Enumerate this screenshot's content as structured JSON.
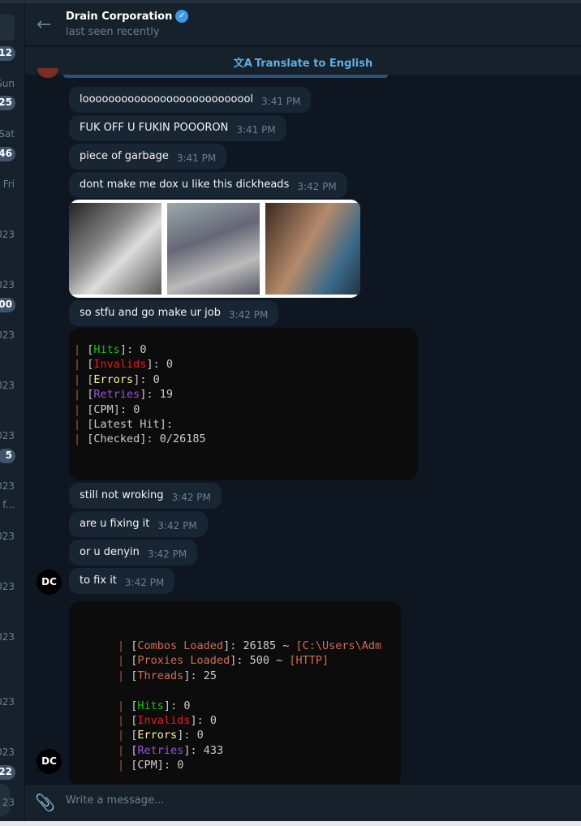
{
  "chat_list_strip": {
    "items": [
      {
        "type": "badge",
        "text": "12"
      },
      {
        "type": "date",
        "text": "Sun"
      },
      {
        "type": "badge",
        "text": "25"
      },
      {
        "type": "date",
        "text": "Sat"
      },
      {
        "type": "badge",
        "text": "46"
      },
      {
        "type": "date",
        "text": "Fri"
      },
      {
        "type": "date",
        "text": "023"
      },
      {
        "type": "date",
        "text": "023"
      },
      {
        "type": "badge",
        "text": "00"
      },
      {
        "type": "date",
        "text": "023"
      },
      {
        "type": "date",
        "text": "023"
      },
      {
        "type": "date",
        "text": "023"
      },
      {
        "type": "badge",
        "text": "5"
      },
      {
        "type": "date",
        "text": "023"
      },
      {
        "type": "date",
        "text": "y f..."
      },
      {
        "type": "date",
        "text": "023"
      },
      {
        "type": "date",
        "text": "023"
      },
      {
        "type": "date",
        "text": "023"
      },
      {
        "type": "date",
        "text": "023"
      },
      {
        "type": "date",
        "text": "023"
      },
      {
        "type": "badge",
        "text": "22"
      },
      {
        "type": "date",
        "text": "23"
      }
    ]
  },
  "header": {
    "title": "Drain Corporation",
    "verified": true,
    "status": "last seen recently",
    "back_icon": "arrow-left-icon"
  },
  "translate_bar": {
    "label": "Translate to English",
    "icon": "translate-icon"
  },
  "messages": [
    {
      "text": "looooooooooooooooooooooooool",
      "time": "3:41 PM"
    },
    {
      "text": "FUK OFF U FUKIN POOORON",
      "time": "3:41 PM"
    },
    {
      "text": "piece of garbage",
      "time": "3:41 PM"
    },
    {
      "text": "dont make me dox u like this dickheads",
      "time": "3:42 PM"
    },
    {
      "text": "so stfu and go make ur job",
      "time": "3:42 PM"
    },
    {
      "text": "still not wroking",
      "time": "3:42 PM"
    },
    {
      "text": "are u fixing it",
      "time": "3:42 PM"
    },
    {
      "text": "or u denyin",
      "time": "3:42 PM"
    },
    {
      "text": "to fix it",
      "time": "3:42 PM"
    }
  ],
  "code1": [
    {
      "label": "Hits",
      "color": "g",
      "value": ": 0"
    },
    {
      "label": "Invalids",
      "color": "r",
      "value": ": 0"
    },
    {
      "label": "Errors",
      "color": "y",
      "value": ": 0"
    },
    {
      "label": "Retries",
      "color": "p",
      "value": ": 19"
    },
    {
      "label": "CPM",
      "color": "",
      "value": ": 0"
    },
    {
      "label": "Latest Hit",
      "color": "",
      "value": ":"
    },
    {
      "label": "Checked",
      "color": "",
      "value": ": 0/26185"
    }
  ],
  "code2": [
    {
      "label": "Combos Loaded",
      "color": "o",
      "value": ": 26185 ~ ",
      "extra": "[C:\\Users\\Adm"
    },
    {
      "label": "Proxies Loaded",
      "color": "o",
      "value": ": 500 ~ ",
      "extra": "[HTTP]"
    },
    {
      "label": "Threads",
      "color": "o",
      "value": ": 25"
    },
    {
      "blank": true
    },
    {
      "label": "Hits",
      "color": "g",
      "value": ": 0"
    },
    {
      "label": "Invalids",
      "color": "r",
      "value": ": 0"
    },
    {
      "label": "Errors",
      "color": "y",
      "value": ": 0"
    },
    {
      "label": "Retries",
      "color": "p",
      "value": ": 433"
    },
    {
      "label": "CPM",
      "color": "",
      "value": ": 0"
    }
  ],
  "avatar_text": "DC",
  "composer": {
    "placeholder": "Write a message...",
    "attach_icon": "paperclip-icon"
  },
  "colors": {
    "background": "#0e1621",
    "bubble": "#182533",
    "accent": "#5eaee8",
    "verified": "#3d9ae8"
  }
}
